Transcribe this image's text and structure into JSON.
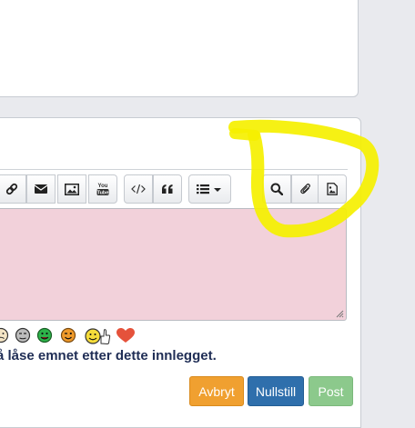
{
  "lock_option": {
    "text": "å låse emnet etter dette innlegget."
  },
  "actions": {
    "cancel_label": "Avbryt",
    "reset_label": "Nullstill",
    "post_label": "Post"
  },
  "toolbar": {
    "buttons": [
      "link-icon",
      "envelope-icon",
      "image-icon",
      "youtube-icon",
      "code-icon",
      "quote-icon",
      "list-dropdown-icon",
      "search-icon",
      "paperclip-icon",
      "image-file-icon"
    ],
    "youtube_icon_text": "You Tube"
  },
  "smileys": [
    "frown-smiley",
    "unamused-smiley",
    "green-smiley",
    "wink-smiley",
    "thumbs-up-smiley",
    "heart"
  ],
  "colors": {
    "textarea_bg": "#f2d1da",
    "cancel": "#f0a030",
    "reset": "#2f6fac",
    "post": "#8cc98c",
    "highlight": "#f5f000",
    "label_text": "#1f2d55"
  }
}
